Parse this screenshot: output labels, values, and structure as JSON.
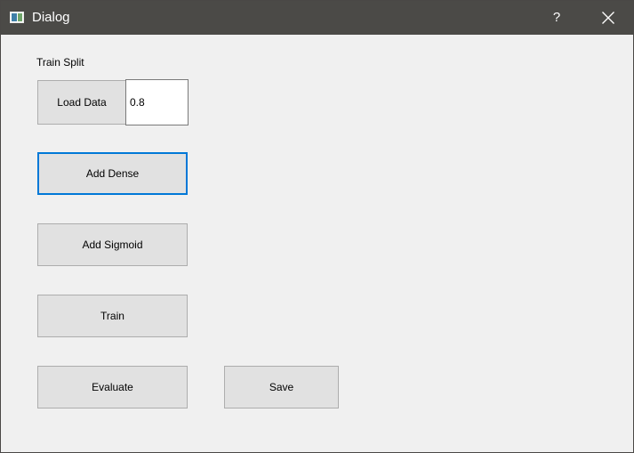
{
  "window": {
    "title": "Dialog",
    "help_label": "?",
    "icons": {
      "app": "dialog-app-icon",
      "close": "close-icon"
    },
    "colors": {
      "titlebar": "#4b4a47",
      "background": "#f0f0f0",
      "button": "#e1e1e1",
      "focus": "#0078d7"
    }
  },
  "form": {
    "train_split_label": "Train Split",
    "train_split_value": "0.8",
    "buttons": {
      "load_data": "Load Data",
      "add_dense": "Add Dense",
      "add_sigmoid": "Add Sigmoid",
      "train": "Train",
      "evaluate": "Evaluate",
      "save": "Save"
    }
  }
}
